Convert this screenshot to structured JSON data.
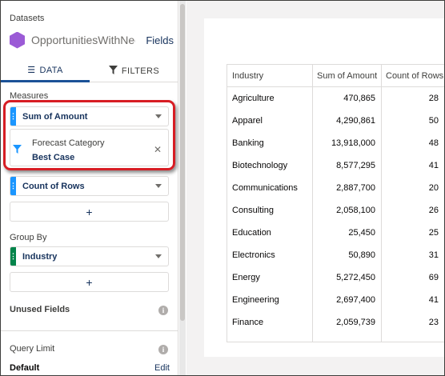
{
  "panel": {
    "datasets_label": "Datasets",
    "dataset_name": "OpportunitiesWithNega...",
    "fields_link": "Fields",
    "tabs": [
      {
        "label": "DATA",
        "active": true
      },
      {
        "label": "FILTERS",
        "active": false
      }
    ],
    "measures_label": "Measures",
    "measures": [
      {
        "label": "Sum of Amount",
        "color": "#1b96ff"
      },
      {
        "label": "Count of Rows",
        "color": "#1b96ff"
      }
    ],
    "filter": {
      "title": "Forecast Category",
      "value": "Best Case",
      "close": "✕"
    },
    "add_label": "+",
    "group_by_label": "Group By",
    "group_by": {
      "label": "Industry",
      "color": "#04844b"
    },
    "unused_fields_label": "Unused Fields",
    "query_limit_label": "Query Limit",
    "default_label": "Default",
    "edit_label": "Edit",
    "info_glyph": "i",
    "highlight_color": "#d71d24"
  },
  "table": {
    "columns": [
      "Industry",
      "Sum of Amount",
      "Count of Rows"
    ],
    "rows": [
      [
        "Agriculture",
        "470,865",
        "28"
      ],
      [
        "Apparel",
        "4,290,861",
        "50"
      ],
      [
        "Banking",
        "13,918,000",
        "48"
      ],
      [
        "Biotechnology",
        "8,577,295",
        "41"
      ],
      [
        "Communications",
        "2,887,700",
        "20"
      ],
      [
        "Consulting",
        "2,058,100",
        "26"
      ],
      [
        "Education",
        "25,450",
        "25"
      ],
      [
        "Electronics",
        "50,890",
        "31"
      ],
      [
        "Energy",
        "5,272,450",
        "69"
      ],
      [
        "Engineering",
        "2,697,400",
        "41"
      ],
      [
        "Finance",
        "2,059,739",
        "23"
      ]
    ]
  }
}
